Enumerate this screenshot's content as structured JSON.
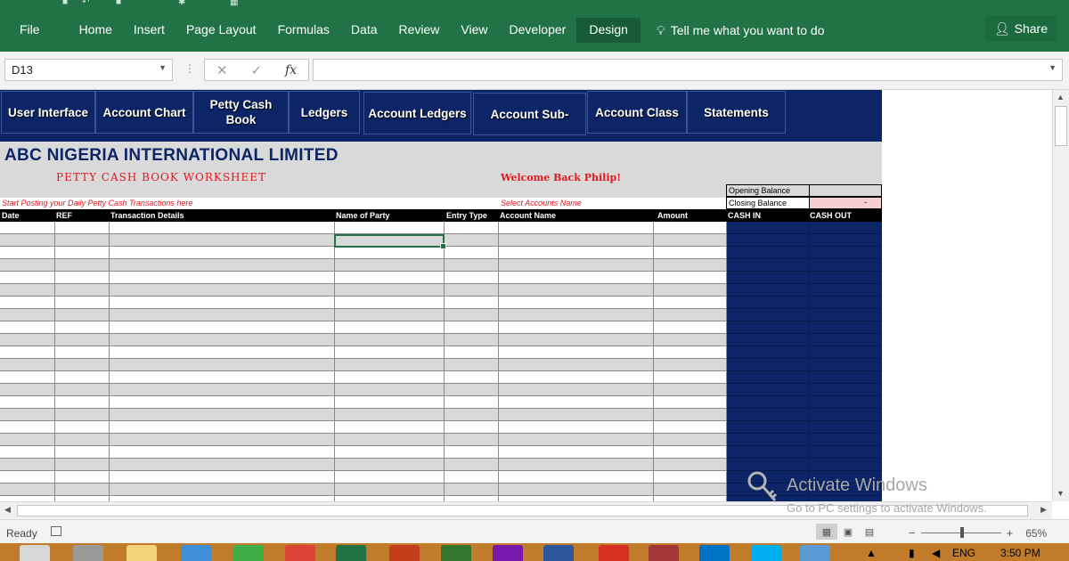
{
  "ribbon": {
    "tabs": [
      "File",
      "Home",
      "Insert",
      "Page Layout",
      "Formulas",
      "Data",
      "Review",
      "View",
      "Developer",
      "Design"
    ],
    "tell_me": "Tell me what you want to do",
    "share": "Share"
  },
  "formula_bar": {
    "name_box": "D13",
    "formula": "",
    "fx": "fx"
  },
  "nav_buttons": [
    "User Interface",
    "Account Chart",
    "Petty Cash Book",
    "Ledgers",
    "Account Ledgers",
    "Account Sub-",
    "Account Class",
    "Statements"
  ],
  "header": {
    "company": "ABC NIGERIA INTERNATIONAL LIMITED",
    "worksheet_title": "PETTY CASH BOOK WORKSHEET",
    "welcome": "Welcome Back Philip!",
    "instruction_left": "Start Posting your Daily Petty Cash Transactions here",
    "instruction_right": "Select Accounts Name",
    "opening_balance_label": "Opening Balance",
    "opening_balance_value": "",
    "closing_balance_label": "Closing Balance",
    "closing_balance_value": "-"
  },
  "table": {
    "columns": [
      "Date",
      "REF",
      "Transaction Details",
      "Name of Party",
      "Entry Type",
      "Account Name",
      "Amount",
      "CASH IN",
      "CASH OUT"
    ]
  },
  "watermark": {
    "title": "Activate Windows",
    "subtitle": "Go to PC settings to activate Windows."
  },
  "status_bar": {
    "ready": "Ready",
    "zoom": "65%"
  },
  "taskbar": {
    "language": "ENG",
    "time": "3:50 PM"
  },
  "colors": {
    "excel_green": "#217346",
    "navy": "#0c2567",
    "header_gray": "#d9d9d9",
    "accent_red": "#e0171e",
    "closing_balance_fill": "#f6d0d0"
  }
}
